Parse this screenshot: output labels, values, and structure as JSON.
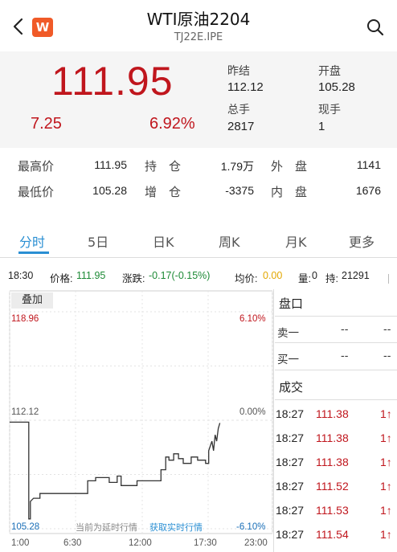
{
  "header": {
    "title": "WTI原油2204",
    "subtitle": "TJ22E.IPE",
    "logo_letter": "W"
  },
  "quote": {
    "price": "111.95",
    "change": "7.25",
    "change_pct": "6.92%",
    "prev_close_label": "昨结",
    "prev_close": "112.12",
    "open_label": "开盘",
    "open": "105.28",
    "volume_label": "总手",
    "volume": "2817",
    "current_hand_label": "现手",
    "current_hand": "1"
  },
  "stats": {
    "high_label": "最高价",
    "high": "111.95",
    "low_label": "最低价",
    "low": "105.28",
    "oi_label": "持　仓",
    "oi": "1.79万",
    "oi_change_label": "增　仓",
    "oi_change": "-3375",
    "outer_label": "外　盘",
    "outer": "1141",
    "inner_label": "内　盘",
    "inner": "1676"
  },
  "tabs": [
    "分时",
    "5日",
    "日K",
    "周K",
    "月K",
    "更多"
  ],
  "info": {
    "time": "18:30",
    "price_label": "价格:",
    "price": "111.95",
    "chg_label": "涨跌:",
    "chg": "-0.17(-0.15%)",
    "avg_label": "均价:",
    "avg": "0.00",
    "vol_label": "量:",
    "vol": "0",
    "oi_label": "持:",
    "oi": "21291"
  },
  "chart": {
    "stack_label": "叠加",
    "y_top": "118.96",
    "y_mid": "112.12",
    "y_bottom": "105.28",
    "pct_top": "6.10%",
    "pct_mid": "0.00%",
    "pct_bottom": "-6.10%",
    "x_labels": [
      "1:00",
      "6:30",
      "12:00",
      "17:30",
      "23:00"
    ],
    "notice": "当前为延时行情",
    "realtime_link": "获取实时行情"
  },
  "chart_data": {
    "type": "line",
    "x": [
      "1:00",
      "6:30",
      "12:00",
      "17:30",
      "23:00"
    ],
    "ylim": [
      105.28,
      118.96
    ],
    "reference": 112.12,
    "series": [
      {
        "values": [
          [
            0,
            112.0
          ],
          [
            24,
            112.0
          ],
          [
            24,
            105.9
          ],
          [
            26,
            105.9
          ],
          [
            26,
            107.0
          ],
          [
            30,
            107.2
          ],
          [
            38,
            107.2
          ],
          [
            38,
            107.5
          ],
          [
            98,
            107.5
          ],
          [
            98,
            108.3
          ],
          [
            108,
            108.3
          ],
          [
            108,
            108.5
          ],
          [
            125,
            108.5
          ],
          [
            125,
            108.2
          ],
          [
            135,
            108.2
          ],
          [
            135,
            108.6
          ],
          [
            140,
            108.6
          ],
          [
            140,
            108.0
          ],
          [
            160,
            108.0
          ],
          [
            160,
            108.3
          ],
          [
            190,
            108.3
          ],
          [
            190,
            109.0
          ],
          [
            196,
            109.0
          ],
          [
            196,
            109.8
          ],
          [
            200,
            109.8
          ],
          [
            200,
            109.6
          ],
          [
            206,
            109.6
          ],
          [
            206,
            110.0
          ],
          [
            212,
            110.0
          ],
          [
            212,
            109.7
          ],
          [
            218,
            109.7
          ],
          [
            218,
            109.4
          ],
          [
            228,
            109.4
          ],
          [
            228,
            109.8
          ],
          [
            236,
            109.8
          ],
          [
            236,
            109.6
          ],
          [
            246,
            109.6
          ],
          [
            246,
            109.4
          ],
          [
            250,
            109.4
          ],
          [
            250,
            110.2
          ],
          [
            254,
            110.8
          ],
          [
            256,
            110.2
          ],
          [
            258,
            111.2
          ],
          [
            260,
            110.8
          ],
          [
            262,
            111.6
          ],
          [
            264,
            111.95
          ]
        ]
      }
    ]
  },
  "panel": {
    "depth_title": "盘口",
    "sell1_label": "卖一",
    "sell1_price": "--",
    "sell1_vol": "--",
    "buy1_label": "买一",
    "buy1_price": "--",
    "buy1_vol": "--",
    "trades_title": "成交",
    "trades": [
      {
        "time": "18:27",
        "price": "111.38",
        "vol": "1↑"
      },
      {
        "time": "18:27",
        "price": "111.38",
        "vol": "1↑"
      },
      {
        "time": "18:27",
        "price": "111.38",
        "vol": "1↑"
      },
      {
        "time": "18:27",
        "price": "111.52",
        "vol": "1↑"
      },
      {
        "time": "18:27",
        "price": "111.53",
        "vol": "1↑"
      },
      {
        "time": "18:27",
        "price": "111.54",
        "vol": "1↑"
      }
    ]
  },
  "colors": {
    "up": "#c0161d",
    "down": "#1d8a36",
    "accent": "#2a8fd3",
    "brand": "#f05a28"
  }
}
